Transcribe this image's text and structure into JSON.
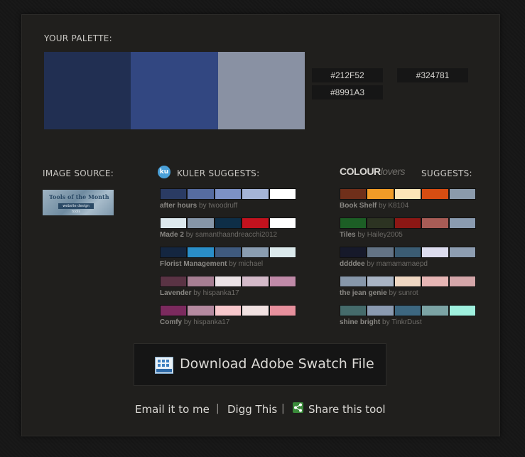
{
  "palette": {
    "heading": "YOUR PALETTE:",
    "swatches": [
      "#212F52",
      "#324781",
      "#8991A3"
    ],
    "hex_codes": [
      "#212F52",
      "#324781",
      "#8991A3"
    ]
  },
  "image_source": {
    "heading": "IMAGE SOURCE:",
    "thumb_title": "Tools of the Month",
    "thumb_subtitle": "website design tools"
  },
  "kuler": {
    "heading": "KULER SUGGESTS:",
    "icon_label": "ku",
    "items": [
      {
        "name": "after hours",
        "by": "by",
        "author": "twoodruff",
        "colors": [
          "#2a3b63",
          "#566ca0",
          "#7c91c5",
          "#a5b4d6",
          "#ffffff"
        ]
      },
      {
        "name": "Made 2",
        "by": "by",
        "author": "samanthaandreacchi2012",
        "colors": [
          "#dde9ee",
          "#8696a8",
          "#0e2e47",
          "#c2121e",
          "#ffffff"
        ]
      },
      {
        "name": "Florist Management",
        "by": "by",
        "author": "michael",
        "colors": [
          "#142640",
          "#2a8ec8",
          "#3f5a7e",
          "#8a9db1",
          "#dbe9ec"
        ]
      },
      {
        "name": "Lavender",
        "by": "by",
        "author": "hispanka17",
        "colors": [
          "#5a3344",
          "#a77f93",
          "#ebe2e6",
          "#d3b9c8",
          "#c08aa8"
        ]
      },
      {
        "name": "Comfy",
        "by": "by",
        "author": "hispanka17",
        "colors": [
          "#7b2a5e",
          "#b58aa0",
          "#f8c8cc",
          "#f1e1e1",
          "#e7909d"
        ]
      }
    ]
  },
  "colourlovers": {
    "logo_bold": "COLOUR",
    "logo_light": "lovers",
    "heading": "SUGGESTS:",
    "items": [
      {
        "name": "Book Shelf",
        "by": "by",
        "author": "K8104",
        "colors": [
          "#6f2f1a",
          "#f19b27",
          "#fde4b6",
          "#d64d12",
          "#8b9aab"
        ]
      },
      {
        "name": "Tiles",
        "by": "by",
        "author": "Hailey2005",
        "colors": [
          "#1c5e25",
          "#2c3322",
          "#8c1714",
          "#a85c56",
          "#8a9bb0"
        ]
      },
      {
        "name": "ddddee",
        "by": "by",
        "author": "mamamamaepd",
        "colors": [
          "#16192a",
          "#637385",
          "#3b5c73",
          "#dcdcee",
          "#8d9db1"
        ]
      },
      {
        "name": "the jean genie",
        "by": "by",
        "author": "sunrot",
        "colors": [
          "#8797aa",
          "#a9b4c4",
          "#f0d8c3",
          "#e7b6b5",
          "#d4a6a9"
        ]
      },
      {
        "name": "shine bright",
        "by": "by",
        "author": "TinkrDust",
        "colors": [
          "#456b6b",
          "#8a9ab0",
          "#3d6780",
          "#7ba3a4",
          "#9ff0de"
        ]
      }
    ]
  },
  "download": {
    "label": "Download Adobe Swatch File"
  },
  "footer": {
    "email": "Email it to me",
    "sep": "|",
    "digg": "Digg This",
    "share": "Share this tool"
  }
}
